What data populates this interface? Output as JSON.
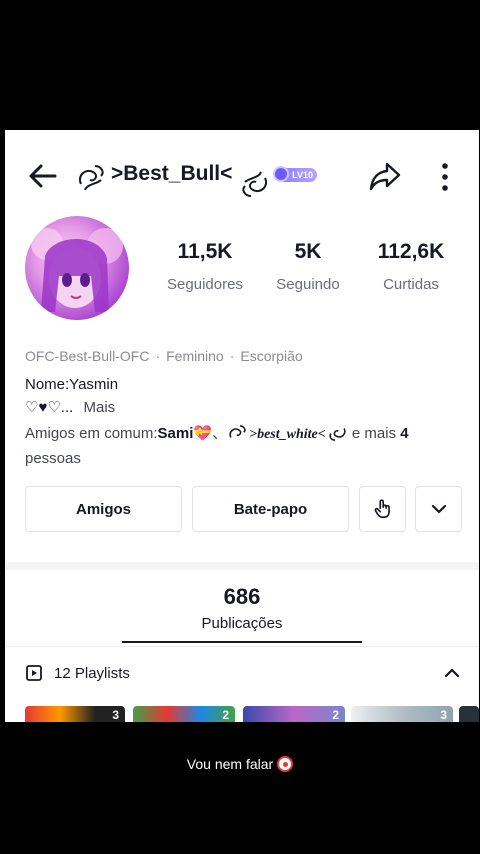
{
  "header": {
    "username": ">Best_Bull<",
    "level_badge": "LV10"
  },
  "stats": [
    {
      "value": "11,5K",
      "label": "Seguidores"
    },
    {
      "value": "5K",
      "label": "Seguindo"
    },
    {
      "value": "112,6K",
      "label": "Curtidas"
    }
  ],
  "meta": {
    "handle": "OFC-Best-Bull-OFC",
    "gender": "Feminino",
    "sign": "Escorpião"
  },
  "bio": {
    "name_line": "Nome:Yasmin",
    "hearts_line": "♡♥♡...",
    "more_label": "Mais"
  },
  "mutual": {
    "prefix": "Amigos em comum:",
    "friend1": "Sami💝",
    "separator": "、",
    "friend2": ">best_white<",
    "suffix": " e mais ",
    "count": "4",
    "tail": "pessoas"
  },
  "buttons": {
    "friends": "Amigos",
    "chat": "Bate-papo"
  },
  "posts": {
    "count": "686",
    "label": "Publicações"
  },
  "playlists": {
    "label": "12 Playlists",
    "thumb_counts": [
      "3",
      "2",
      "2",
      "3"
    ]
  },
  "caption": {
    "text": "Vou nem falar"
  },
  "colors": {
    "accent_badge": "#8a7dff",
    "text_primary": "#161823",
    "text_secondary": "#6b6e78"
  },
  "icons": [
    "back-arrow-icon",
    "swirl-icon",
    "share-icon",
    "more-vertical-icon",
    "tap-hand-icon",
    "chevron-down-icon",
    "playlist-icon",
    "chevron-up-icon",
    "clown-emoji-icon"
  ]
}
